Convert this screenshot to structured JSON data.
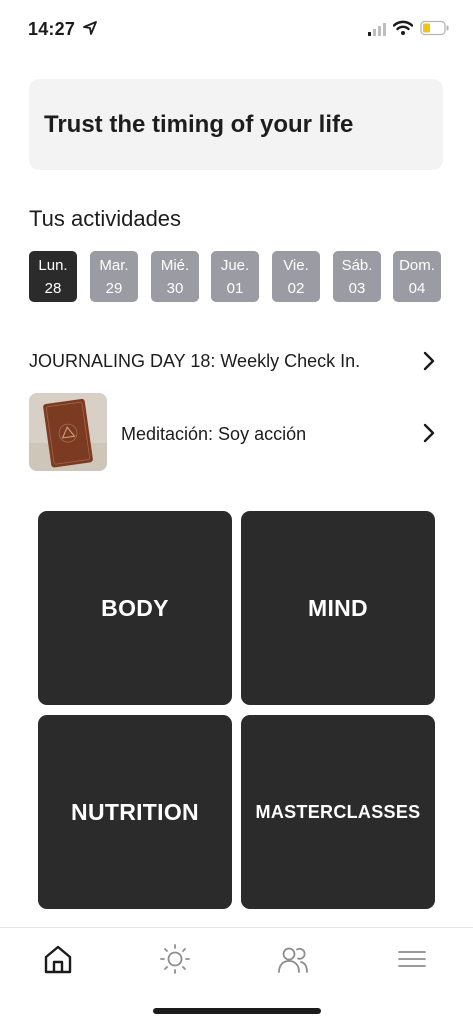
{
  "status_bar": {
    "time": "14:27"
  },
  "quote": {
    "text": "Trust the timing of your life"
  },
  "activities": {
    "title": "Tus actividades",
    "days": [
      {
        "name": "Lun.",
        "num": "28",
        "active": true
      },
      {
        "name": "Mar.",
        "num": "29",
        "active": false
      },
      {
        "name": "Mié.",
        "num": "30",
        "active": false
      },
      {
        "name": "Jue.",
        "num": "01",
        "active": false
      },
      {
        "name": "Vie.",
        "num": "02",
        "active": false
      },
      {
        "name": "Sáb.",
        "num": "03",
        "active": false
      },
      {
        "name": "Dom.",
        "num": "04",
        "active": false
      }
    ],
    "items": [
      {
        "label": "JOURNALING DAY 18: Weekly Check In."
      },
      {
        "label": "Meditación: Soy acción"
      }
    ]
  },
  "categories": [
    {
      "label": "BODY"
    },
    {
      "label": "MIND"
    },
    {
      "label": "NUTRITION"
    },
    {
      "label": "MASTERCLASSES"
    }
  ],
  "tabbar": {
    "tabs": [
      {
        "icon": "home-icon"
      },
      {
        "icon": "sun-icon"
      },
      {
        "icon": "people-icon"
      },
      {
        "icon": "menu-icon"
      }
    ]
  },
  "colors": {
    "dark_tile": "#2b2b2b",
    "day_inactive": "#9b9ca3",
    "card_bg": "#f3f3f3"
  }
}
